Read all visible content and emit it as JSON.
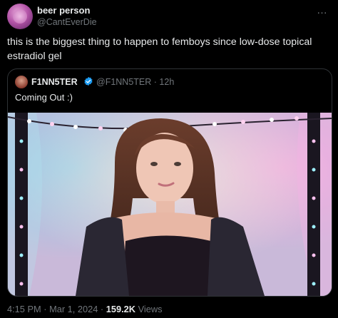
{
  "tweet": {
    "author_name": "beer person",
    "author_handle": "@CantEverDie",
    "text": "this is the biggest thing to happen to femboys since low-dose topical estradiol gel",
    "more_icon": "…",
    "time": "4:15 PM",
    "date": "Mar 1, 2024",
    "views_count": "159.2K",
    "views_label": "Views",
    "separator": "·"
  },
  "quoted": {
    "author_name": "F1NN5TER",
    "author_handle": "@F1NN5TER",
    "age": "· 12h",
    "text": "Coming Out :)",
    "verified_color": "#1d9bf0"
  },
  "colors": {
    "background": "#000000",
    "secondary_text": "#71767b",
    "primary_text": "#e7e9ea"
  }
}
